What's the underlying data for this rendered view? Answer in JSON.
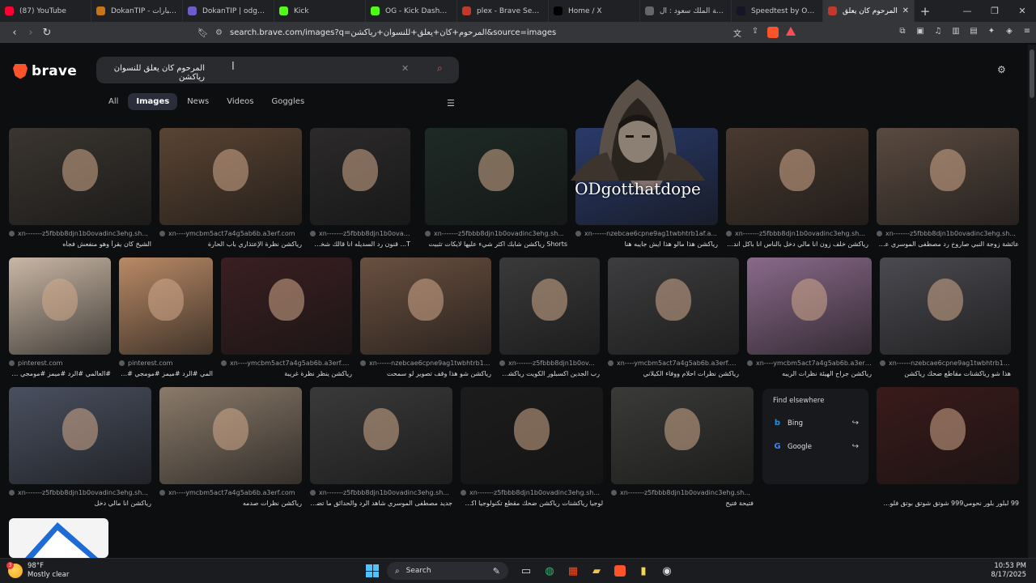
{
  "tabs": [
    {
      "title": "(87) YouTube",
      "icon": "youtube-icon",
      "color": "#ff0033",
      "active": false
    },
    {
      "title": "DokanTIP - الإختبارات",
      "icon": "dokantip-icon",
      "color": "#c9741a",
      "active": false
    },
    {
      "title": "DokanTIP | odgotthatd",
      "icon": "dokantip-icon",
      "color": "#6d5cc9",
      "active": false
    },
    {
      "title": "Kick",
      "icon": "kick-icon",
      "color": "#53fc18",
      "active": false
    },
    {
      "title": "OG - Kick Dashboard",
      "icon": "kick-icon",
      "color": "#53fc18",
      "active": false
    },
    {
      "title": "plex - Brave Search",
      "icon": "brave-search-icon",
      "color": "#c0392b",
      "active": false
    },
    {
      "title": "Home / X",
      "icon": "x-icon",
      "color": "#000000",
      "active": false
    },
    {
      "title": "جامعة الملك سعود : ال",
      "icon": "globe-icon",
      "color": "#666666",
      "active": false
    },
    {
      "title": "Speedtest by Ookla - T",
      "icon": "speedtest-icon",
      "color": "#141526",
      "active": false
    },
    {
      "title": "المرحوم كان يعلق",
      "icon": "brave-search-icon",
      "color": "#c0392b",
      "active": true
    }
  ],
  "address_bar": {
    "url": "search.brave.com/images?q=المرحوم+كان+يعلق+للنسوان+رياكشن&source=images"
  },
  "brand": {
    "name": "brave",
    "accent": "#fb542b"
  },
  "search": {
    "query": "المرحوم كان يعلق للنسوان رياكشن"
  },
  "search_tabs": [
    {
      "label": "All",
      "active": false
    },
    {
      "label": "Images",
      "active": true
    },
    {
      "label": "News",
      "active": false
    },
    {
      "label": "Videos",
      "active": false
    },
    {
      "label": "Goggles",
      "active": false
    }
  ],
  "overlay": {
    "text": "ODgotthatdope"
  },
  "results_row1": [
    {
      "source": "xn-------z5fbbb8djn1b0ovadinc3ehg.sh...",
      "caption": "الشيخ كان يقرأ وهو منفعش فجأه",
      "bg": "#3a3530"
    },
    {
      "source": "xn----ymcbm5act7a4g5ab6b.a3erf.com",
      "caption": "رياكشن نظرة الإعتذاري باب الحارة",
      "bg": "#5a4433"
    },
    {
      "source": "xn-------z5fbbb8djn1b0ovad...",
      "caption": "T... قنون رد السديله انا قالك شخص ما و بك دخلك",
      "bg": "#2c2a2a"
    },
    {
      "source": "xn-------z5fbbb8djn1b0ovadinc3ehg.sh...",
      "caption": "Shorts رياكشن شابك اكثر شيء عليها لايكات تثبيت",
      "bg": "#1e2a26"
    },
    {
      "source": "xn------nzebcae6cpne9ag1twbhtrb1af.a...",
      "caption": "رياكشن هذا مالو هذا ايش جايبه هنا",
      "bg": "#2a3a6a"
    },
    {
      "source": "xn-------z5fbbb8djn1b0ovadinc3ehg.sh...",
      "caption": "رياكشن خلف زون انا مالي دخل بالناس انا باكل اندومي وبس",
      "bg": "#4a3a30"
    },
    {
      "source": "xn-------z5fbbb8djn1b0ovadinc3ehg.sh...",
      "caption": "عائشة زوجة النبي صاروخ رد مصطفى الموسري على فليكس",
      "bg": "#5a4a40"
    }
  ],
  "results_row2": [
    {
      "source": "pinterest.com",
      "caption": "#العالمي #الرد #ميمز #مومجي #للسحرية#...",
      "bg": "#c9b7a5"
    },
    {
      "source": "pinterest.com",
      "caption": "المي #الرد #ميمز #مومجي #سحرية#...",
      "bg": "#b98a66"
    },
    {
      "source": "xn----ymcbm5act7a4g5ab6b.a3erf.c...",
      "caption": "رياكشن ينظر نظرة غريبة",
      "bg": "#3a1f22"
    },
    {
      "source": "xn------nzebcae6cpne9ag1twbhtrb1...",
      "caption": "رياكشن شو هذا وقف تصوير لو سمحت",
      "bg": "#6a5040"
    },
    {
      "source": "xn-------z5fbbb8djn1b0ov...",
      "caption": "رب الجدين اكسبلور الكويت رياكشن ضحك",
      "bg": "#3a3a3a"
    },
    {
      "source": "xn----ymcbm5act7a4g5ab6b.a3erf.c...",
      "caption": "رياكشن نظرات احلام ووفاء الكيلاني",
      "bg": "#3d3d3f"
    },
    {
      "source": "xn----ymcbm5act7a4g5ab6b.a3erf.c...",
      "caption": "رياكشن جراح الهيئة نظرات الريبه",
      "bg": "#8a6a8a"
    },
    {
      "source": "xn------nzebcae6cpne9ag1twbhtrb1...",
      "caption": "هذا شو رياكشنات مقاطع ضحك رياكشن",
      "bg": "#4a4a50"
    }
  ],
  "results_row3": [
    {
      "source": "xn-------z5fbbb8djn1b0ovadinc3ehg.sh...",
      "caption": "رياكشن انا مالي دخل",
      "bg": "#4a5060"
    },
    {
      "source": "xn----ymcbm5act7a4g5ab6b.a3erf.com",
      "caption": "رياكشن نظرات صدمه",
      "bg": "#8a7a6a"
    },
    {
      "source": "xn-------z5fbbb8djn1b0ovadinc3ehg.sh...",
      "caption": "جديد مصطفى الموسري شاهد الرد والحدائق ما تضحك",
      "bg": "#3a3a3a"
    },
    {
      "source": "xn-------z5fbbb8djn1b0ovadinc3ehg.sh...",
      "caption": "لوجيا رياكشنات رياكشن ضحك مقطع تكنولوجيا اكسبلور سيارات",
      "bg": "#1c1c1c"
    },
    {
      "source": "xn-------z5fbbb8djn1b0ovadinc3ehg.sh...",
      "caption": "فتيحة فتيح",
      "bg": "#3a3a38"
    },
    {
      "source": "",
      "caption": "99 لبلور بلور نحومي999 شوتق شوتق بوتق فلوس فورفول",
      "bg": "#3a1a1a"
    }
  ],
  "find_elsewhere": {
    "heading": "Find elsewhere",
    "engines": [
      {
        "label": "Bing",
        "icon": "bing-icon",
        "color": "#2a8fd6"
      },
      {
        "label": "Google",
        "icon": "google-icon",
        "color": "#4285f4"
      }
    ]
  },
  "taskbar": {
    "weather_temp": "98°F",
    "weather_desc": "Mostly clear",
    "notification_count": "3",
    "search_label": "Search",
    "time": "10:53 PM",
    "date": "8/17/2025"
  }
}
